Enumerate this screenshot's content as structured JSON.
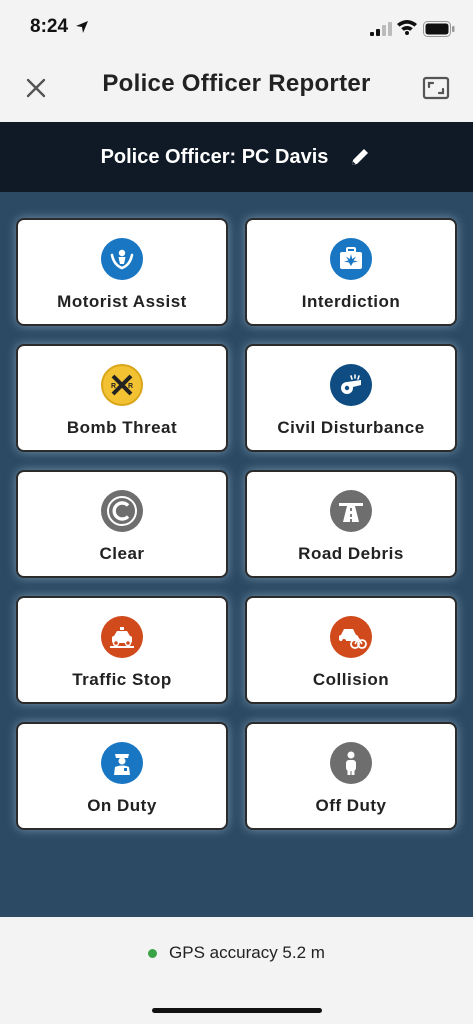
{
  "status": {
    "time": "8:24",
    "icons": [
      "location-arrow-icon",
      "signal-icon",
      "wifi-icon",
      "battery-icon"
    ]
  },
  "nav": {
    "title": "Police Officer Reporter",
    "close_icon": "close-icon",
    "expand_icon": "expand-icon"
  },
  "officer": {
    "label": "Police Officer: PC Davis",
    "edit_icon": "pencil-icon"
  },
  "tiles": [
    {
      "label": "Motorist Assist",
      "icon": "motorist-assist-icon",
      "color": "#1876c3"
    },
    {
      "label": "Interdiction",
      "icon": "interdiction-icon",
      "color": "#1876c3"
    },
    {
      "label": "Bomb Threat",
      "icon": "railroad-crossing-icon",
      "color": "#f2c232"
    },
    {
      "label": "Civil Disturbance",
      "icon": "whistle-icon",
      "color": "#0e4c82"
    },
    {
      "label": "Clear",
      "icon": "clear-icon",
      "color": "#6e6e6e"
    },
    {
      "label": "Road Debris",
      "icon": "road-icon",
      "color": "#6e6e6e"
    },
    {
      "label": "Traffic Stop",
      "icon": "traffic-stop-icon",
      "color": "#d04a1c"
    },
    {
      "label": "Collision",
      "icon": "collision-icon",
      "color": "#d04a1c"
    },
    {
      "label": "On Duty",
      "icon": "officer-icon",
      "color": "#1876c3"
    },
    {
      "label": "Off Duty",
      "icon": "person-icon",
      "color": "#6e6e6e"
    }
  ],
  "footer": {
    "gps_text": "GPS accuracy 5.2 m",
    "gps_status_color": "#3aa345"
  }
}
